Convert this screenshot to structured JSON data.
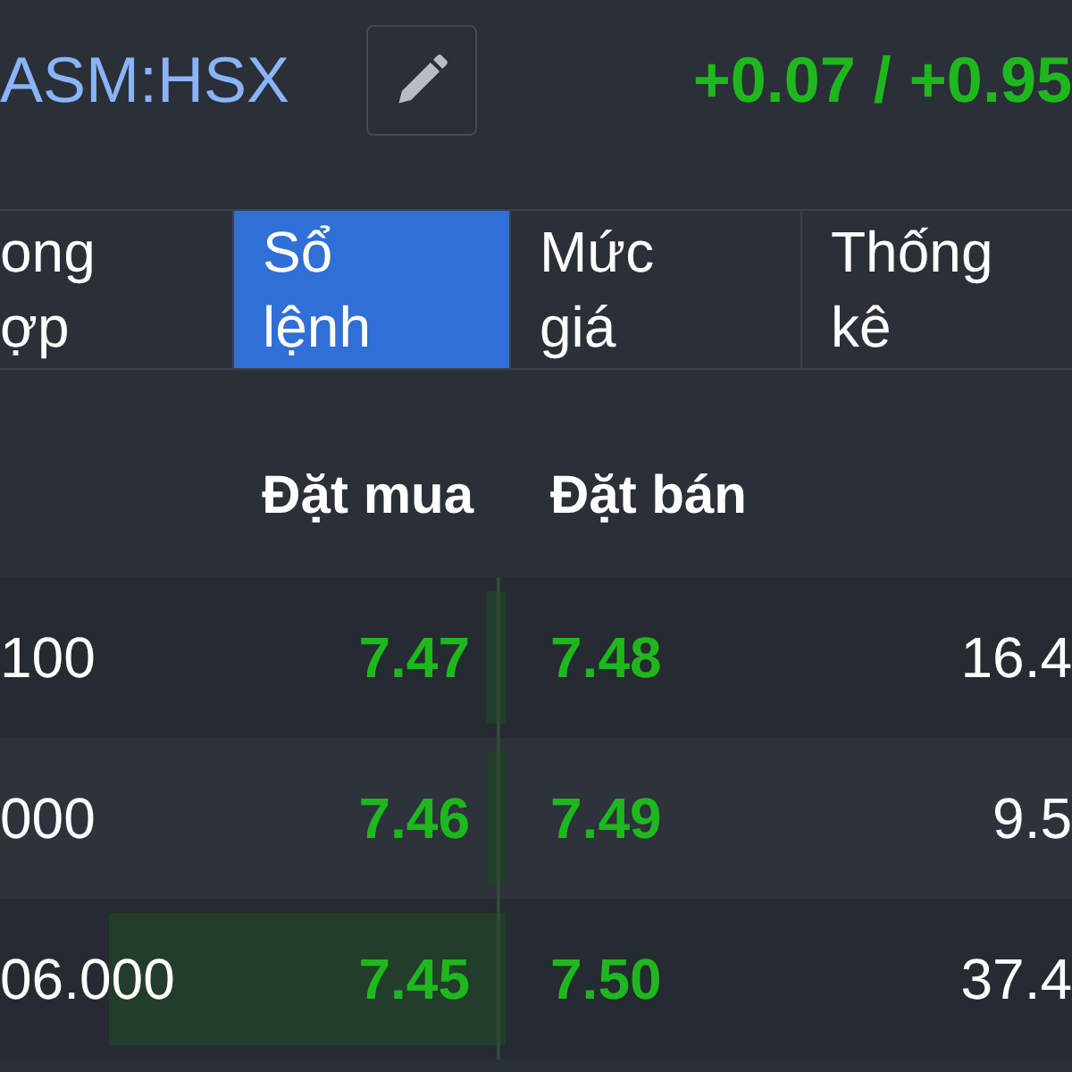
{
  "header": {
    "symbol": "ASM:HSX",
    "change": "+0.07 / +0.95"
  },
  "tabs": [
    {
      "lines": [
        "ong",
        "ợp"
      ],
      "selected": false
    },
    {
      "lines": [
        "Sổ",
        "lệnh"
      ],
      "selected": true
    },
    {
      "lines": [
        "Mức",
        "giá"
      ],
      "selected": false
    },
    {
      "lines": [
        "Thống",
        "kê"
      ],
      "selected": false
    }
  ],
  "columns": {
    "bid": "Đặt mua",
    "ask": "Đặt bán"
  },
  "rows": [
    {
      "bid_volume": "100",
      "bid_price": "7.47",
      "bid_depth": {
        "level": 0.02
      },
      "ask_price": "7.48",
      "ask_volume": "16.4",
      "ask_depth": {
        "level": 0.01
      }
    },
    {
      "bid_volume": "000",
      "bid_price": "7.46",
      "bid_depth": {
        "level": 0.02
      },
      "ask_price": "7.49",
      "ask_volume": "9.5",
      "ask_depth": {
        "level": 0.01
      }
    },
    {
      "bid_volume": "06.000",
      "bid_price": "7.45",
      "bid_depth": {
        "level": 0.78
      },
      "ask_price": "7.50",
      "ask_volume": "37.4",
      "ask_depth": {
        "level": 0.01
      }
    }
  ]
}
